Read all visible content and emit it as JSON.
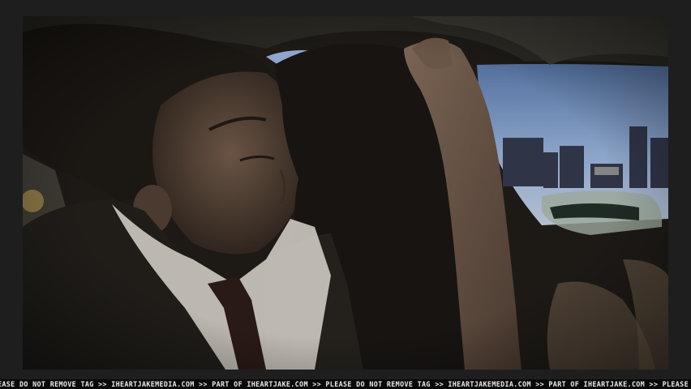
{
  "watermark": {
    "text": "EASE DO NOT REMOVE TAG >> IHEARTJAKEMEDIA.COM >> PART OF IHEARTJAKE.COM >> PLEASE DO NOT REMOVE TAG >> IHEARTJAKEMEDIA.COM >> PART OF IHEARTJAKE.COM >> PLEASE DO NOT REMOVE TAG >> IHEARTJAKEN"
  },
  "colors": {
    "letterbox": "#1e1e1e",
    "sky": "#7d97bd",
    "car_interior": "#1d1a16",
    "tag_text": "#e8e8e8"
  }
}
